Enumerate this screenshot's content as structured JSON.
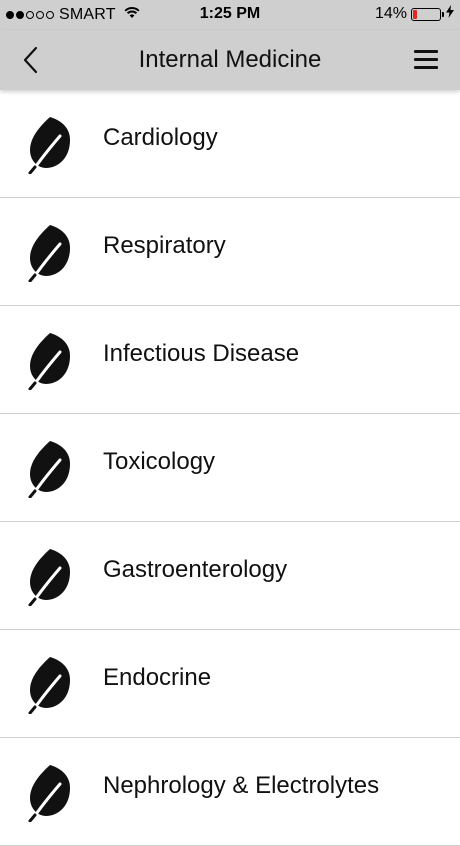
{
  "status_bar": {
    "signal_dots": [
      true,
      true,
      false,
      false,
      false
    ],
    "carrier": "SMART",
    "time": "1:25 PM",
    "battery_percent": "14%",
    "battery_level": 0.14,
    "battery_color": "#e0281f",
    "icons": [
      "wifi-icon",
      "battery-icon",
      "bolt-icon"
    ]
  },
  "header": {
    "title": "Internal Medicine",
    "back_icon": "chevron-left-icon",
    "menu_icon": "hamburger-menu-icon",
    "background": "#cfcfcf"
  },
  "categories": [
    {
      "label": "Cardiology",
      "icon": "leaf-icon"
    },
    {
      "label": "Respiratory",
      "icon": "leaf-icon"
    },
    {
      "label": "Infectious Disease",
      "icon": "leaf-icon"
    },
    {
      "label": "Toxicology",
      "icon": "leaf-icon"
    },
    {
      "label": "Gastroenterology",
      "icon": "leaf-icon"
    },
    {
      "label": "Endocrine",
      "icon": "leaf-icon"
    },
    {
      "label": "Nephrology & Electrolytes",
      "icon": "leaf-icon"
    }
  ]
}
